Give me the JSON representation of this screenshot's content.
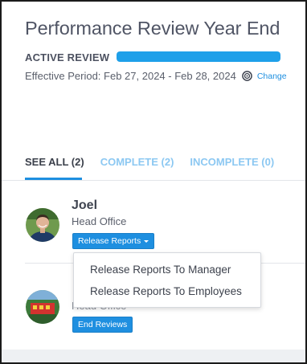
{
  "header": {
    "title": "Performance Review Year End",
    "status": "ACTIVE REVIEW",
    "progress_fraction": 1.0,
    "period": "Effective Period: Feb 27, 2024 - Feb 28, 2024",
    "change_link": "Change"
  },
  "tabs": [
    {
      "label": "SEE ALL (2)",
      "active": true
    },
    {
      "label": "COMPLETE (2)",
      "active": false
    },
    {
      "label": "INCOMPLETE (0)",
      "active": false
    }
  ],
  "reviews": [
    {
      "name": "Joel",
      "department": "Head Office",
      "action_label": "Release Reports",
      "avatar_icon": "person-avatar-icon"
    },
    {
      "partial_text": "Head Office",
      "action_label": "End Reviews",
      "avatar_icon": "colorful-avatar-icon"
    }
  ],
  "dropdown": {
    "items": [
      "Release Reports To Manager",
      "Release Reports To Employees"
    ]
  },
  "colors": {
    "accent": "#1e8fe0",
    "progress": "#1ea0e9",
    "tab_inactive": "#8cc8f2"
  }
}
